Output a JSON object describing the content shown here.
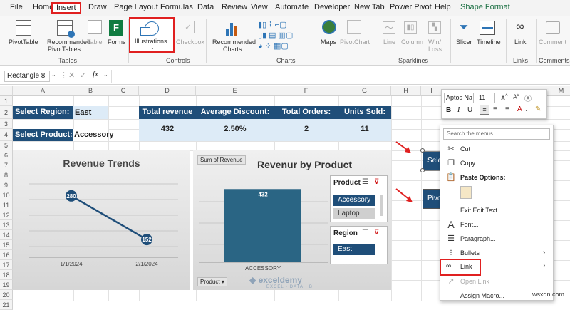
{
  "menu": {
    "file": "File",
    "home": "Home",
    "insert": "Insert",
    "draw": "Draw",
    "page_layout": "Page Layout",
    "formulas": "Formulas",
    "data": "Data",
    "review": "Review",
    "view": "View",
    "automate": "Automate",
    "developer": "Developer",
    "new_tab": "New Tab",
    "power_pivot": "Power Pivot",
    "help": "Help",
    "shape_format": "Shape Format"
  },
  "ribbon": {
    "pivottable": "PivotTable",
    "recommended_pivottables": [
      "Recommended",
      "PivotTables"
    ],
    "table": "Table",
    "forms": "Forms",
    "illustrations": "Illustrations",
    "checkbox": "Checkbox",
    "recommended_charts": [
      "Recommended",
      "Charts"
    ],
    "maps": "Maps",
    "pivotchart": "PivotChart",
    "line": "Line",
    "column": "Column",
    "winloss": [
      "Win/",
      "Loss"
    ],
    "slicer": "Slicer",
    "timeline": "Timeline",
    "link": "Link",
    "comment": "Comment",
    "groups": {
      "tables": "Tables",
      "controls": "Controls",
      "charts": "Charts",
      "sparklines": "Sparklines",
      "links": "Links",
      "comments": "Comments"
    }
  },
  "formula_bar": {
    "name_box": "Rectangle 8",
    "fx": "fx"
  },
  "columns": [
    "A",
    "B",
    "C",
    "D",
    "E",
    "F",
    "G",
    "H",
    "I",
    "M"
  ],
  "rows": [
    "1",
    "2",
    "3",
    "4",
    "5",
    "6",
    "7",
    "8",
    "9",
    "10",
    "11",
    "12",
    "13",
    "14",
    "15",
    "16",
    "17",
    "18",
    "19",
    "20",
    "21"
  ],
  "dashboard": {
    "select_region_label": "Select Region:",
    "select_region_value": "East",
    "select_product_label": "Select Product:",
    "select_product_value": "Accessory",
    "headers": [
      "Total revenue",
      "Average Discount:",
      "Total Orders:",
      "Units Sold:"
    ],
    "values": [
      "432",
      "2.50%",
      "2",
      "11"
    ]
  },
  "chart1": {
    "title": "Revenue Trends",
    "x_labels": [
      "1/1/2024",
      "2/1/2024"
    ],
    "data_labels": [
      "280",
      "152"
    ],
    "chart_data": {
      "type": "line",
      "categories": [
        "1/1/2024",
        "2/1/2024"
      ],
      "values": [
        280,
        152
      ],
      "title": "Revenue Trends"
    }
  },
  "chart2": {
    "field_button": "Sum of Revenue",
    "title": "Revenur by Product",
    "category": "ACCESSORY",
    "data_label": "432",
    "product_field": "Product",
    "chart_data": {
      "type": "bar",
      "categories": [
        "ACCESSORY"
      ],
      "values": [
        432
      ],
      "title": "Revenur by Product"
    }
  },
  "slicer_product": {
    "title": "Product",
    "items": [
      "Accessory",
      "Laptop"
    ]
  },
  "slicer_region": {
    "title": "Region",
    "items": [
      "East"
    ]
  },
  "watermark": {
    "name": "exceldemy",
    "tagline": "EXCEL · DATA · BI"
  },
  "minitoolbar": {
    "font": "Aptos Na",
    "size": "11"
  },
  "shapes": {
    "shape1": "Sele",
    "shape2": "Pivo"
  },
  "context_menu": {
    "search": "Search the menus",
    "cut": "Cut",
    "copy": "Copy",
    "paste_options": "Paste Options:",
    "exit_edit": "Exit Edit Text",
    "font": "Font...",
    "paragraph": "Paragraph...",
    "bullets": "Bullets",
    "link": "Link",
    "open_link": "Open Link",
    "assign_macro": "Assign Macro..."
  },
  "site": "wsxdn.com",
  "colors": {
    "dark_blue": "#1f4e79",
    "light_blue": "#ddebf7",
    "highlight": "#e02020"
  }
}
